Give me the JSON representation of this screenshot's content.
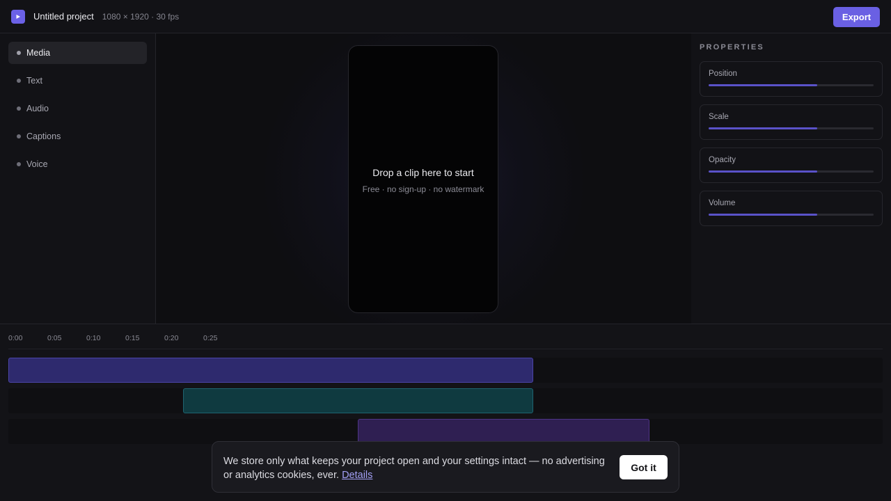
{
  "header": {
    "project_title": "Untitled project",
    "project_meta": "1080 × 1920 · 30 fps",
    "export_label": "Export",
    "logo_icon": "play-icon"
  },
  "sidebar": {
    "items": [
      {
        "label": "Media",
        "active": true
      },
      {
        "label": "Text",
        "active": false
      },
      {
        "label": "Audio",
        "active": false
      },
      {
        "label": "Captions",
        "active": false
      },
      {
        "label": "Voice",
        "active": false
      }
    ]
  },
  "stage": {
    "drop_title": "Drop a clip here to start",
    "drop_subtitle": "Free · no sign-up · no watermark"
  },
  "properties": {
    "title": "PROPERTIES",
    "items": [
      {
        "label": "Position",
        "value": 0.66
      },
      {
        "label": "Scale",
        "value": 0.66
      },
      {
        "label": "Opacity",
        "value": 0.66
      },
      {
        "label": "Volume",
        "value": 0.66
      }
    ]
  },
  "timeline": {
    "ticks": [
      "0:00",
      "0:05",
      "0:10",
      "0:15",
      "0:20",
      "0:25"
    ],
    "clips": [
      {
        "track": "video",
        "color": "#2e2a6e",
        "border": "#4b45a8"
      },
      {
        "track": "text",
        "color": "#0f3a40",
        "border": "#1e6470"
      },
      {
        "track": "audio",
        "color": "#2f1f52",
        "border": "#4e3586"
      }
    ]
  },
  "cookie_banner": {
    "message": "We store only what keeps your project open and your settings intact — no advertising or analytics cookies, ever.",
    "link_label": "Details",
    "accept_label": "Got it"
  },
  "colors": {
    "accent": "#6a60e3",
    "background": "#121216"
  }
}
